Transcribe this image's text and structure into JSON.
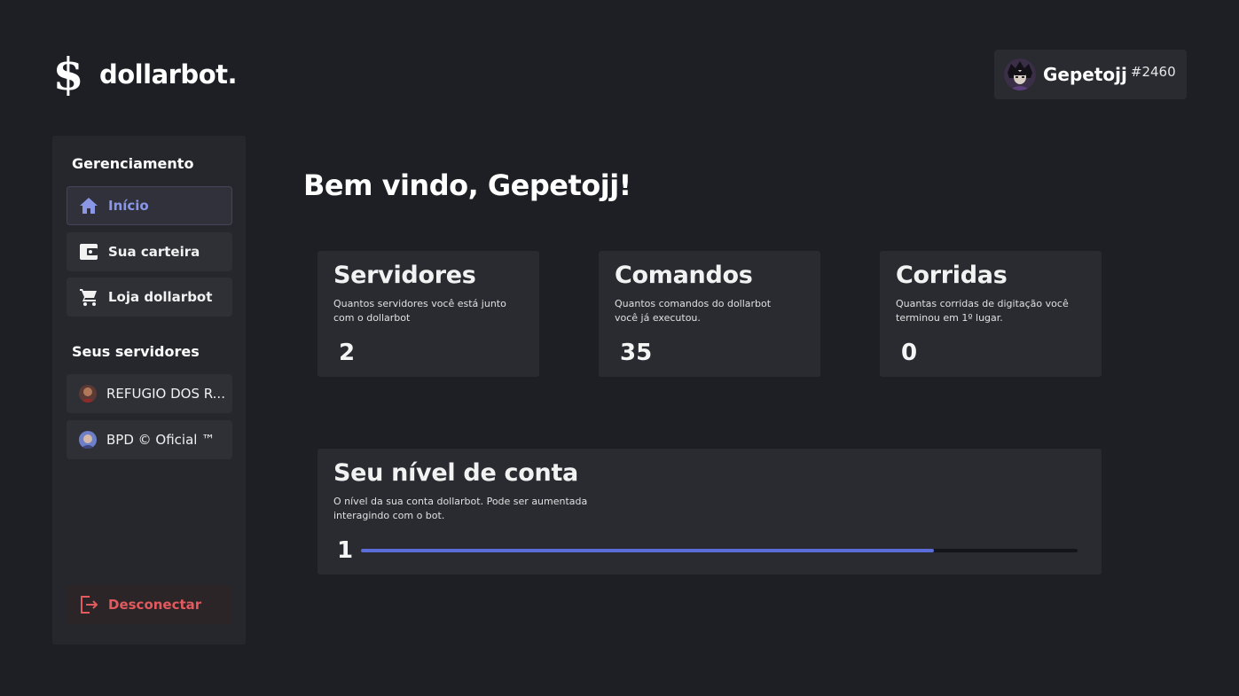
{
  "brand": {
    "logo_glyph": "$",
    "name": "dollarbot."
  },
  "user": {
    "name": "Gepetojj",
    "tag": "#2460",
    "avatar_icon": "user-avatar"
  },
  "sidebar": {
    "management_title": "Gerenciamento",
    "items": [
      {
        "label": "Início",
        "icon": "home-icon",
        "active": true
      },
      {
        "label": "Sua carteira",
        "icon": "wallet-icon"
      },
      {
        "label": "Loja dollarbot",
        "icon": "cart-icon"
      }
    ],
    "servers_title": "Seus servidores",
    "servers": [
      {
        "label": "REFUGIO DOS R...",
        "icon": "server-avatar"
      },
      {
        "label": "BPD © Oficial ™",
        "icon": "server-avatar"
      }
    ],
    "logout_label": "Desconectar"
  },
  "welcome": "Bem vindo, Gepetojj!",
  "stats": [
    {
      "title": "Servidores",
      "desc": "Quantos servidores você está junto com o dollarbot",
      "value": "2"
    },
    {
      "title": "Comandos",
      "desc": "Quantos comandos do dollarbot você já executou.",
      "value": "35"
    },
    {
      "title": "Corridas",
      "desc": "Quantas corridas de digitação você terminou em 1º lugar.",
      "value": "0"
    }
  ],
  "level": {
    "title": "Seu nível de conta",
    "desc": "O nível da sua conta dollarbot. Pode ser aumentada interagindo com o bot.",
    "value": "1",
    "progress": 0.8
  },
  "colors": {
    "accent": "#5b6dd9",
    "active_text": "#8a97e6",
    "danger": "#e05a5e",
    "background": "#1e1f24",
    "card": "#2a2b31"
  }
}
